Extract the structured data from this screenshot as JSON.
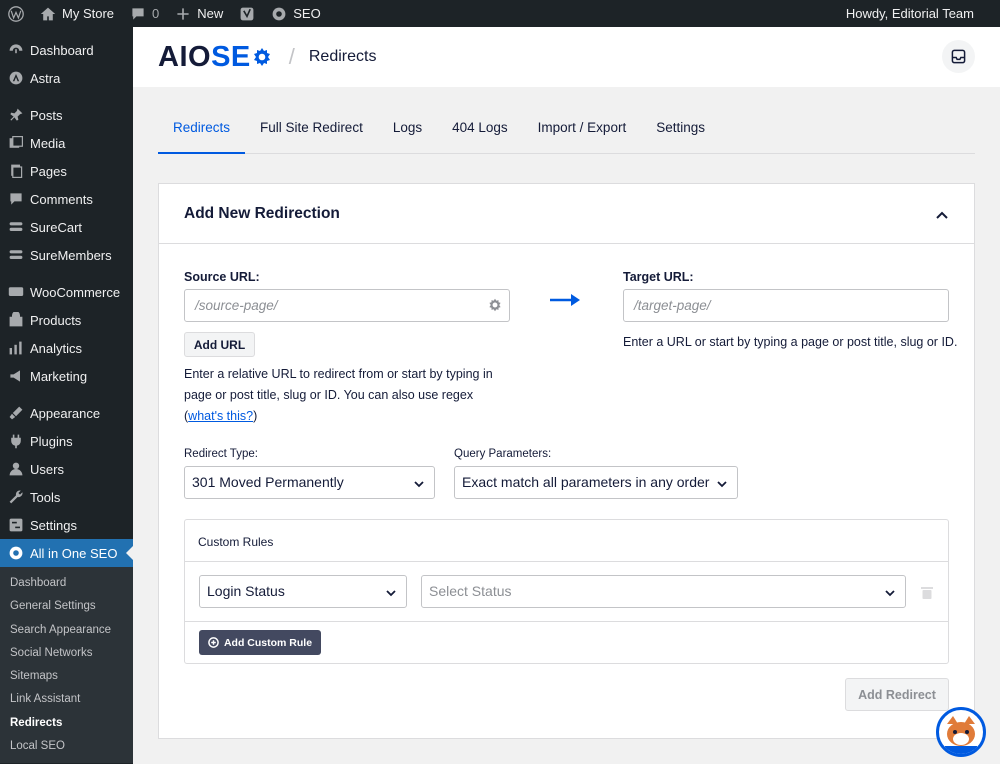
{
  "adminbar": {
    "site": "My Store",
    "comments": "0",
    "new": "New",
    "seo": "SEO",
    "howdy": "Howdy, Editorial Team"
  },
  "sidebar": {
    "items": [
      {
        "label": "Dashboard",
        "icon": "dashboard-icon"
      },
      {
        "label": "Astra",
        "icon": "astra-icon"
      },
      {
        "label": "Posts",
        "icon": "pin-icon"
      },
      {
        "label": "Media",
        "icon": "media-icon"
      },
      {
        "label": "Pages",
        "icon": "pages-icon"
      },
      {
        "label": "Comments",
        "icon": "comment-icon"
      },
      {
        "label": "SureCart",
        "icon": "surecart-icon"
      },
      {
        "label": "SureMembers",
        "icon": "suremembers-icon"
      },
      {
        "label": "WooCommerce",
        "icon": "woocommerce-icon"
      },
      {
        "label": "Products",
        "icon": "products-icon"
      },
      {
        "label": "Analytics",
        "icon": "analytics-icon"
      },
      {
        "label": "Marketing",
        "icon": "megaphone-icon"
      },
      {
        "label": "Appearance",
        "icon": "brush-icon"
      },
      {
        "label": "Plugins",
        "icon": "plug-icon"
      },
      {
        "label": "Users",
        "icon": "user-icon"
      },
      {
        "label": "Tools",
        "icon": "wrench-icon"
      },
      {
        "label": "Settings",
        "icon": "settings-icon"
      },
      {
        "label": "All in One SEO",
        "icon": "aioseo-icon"
      }
    ],
    "submenu": [
      "Dashboard",
      "General Settings",
      "Search Appearance",
      "Social Networks",
      "Sitemaps",
      "Link Assistant",
      "Redirects",
      "Local SEO"
    ]
  },
  "header": {
    "logo_a": "AIO",
    "logo_b": "SE",
    "logo_c": "",
    "title": "Redirects"
  },
  "tabs": [
    "Redirects",
    "Full Site Redirect",
    "Logs",
    "404 Logs",
    "Import / Export",
    "Settings"
  ],
  "card": {
    "title": "Add New Redirection",
    "source_label": "Source URL:",
    "source_placeholder": "/source-page/",
    "add_url": "Add URL",
    "source_hint_pre": "Enter a relative URL to redirect from or start by typing in page or post title, slug or ID. You can also use regex (",
    "source_hint_link": "what's this?",
    "source_hint_post": ")",
    "target_label": "Target URL:",
    "target_placeholder": "/target-page/",
    "target_hint": "Enter a URL or start by typing a page or post title, slug or ID.",
    "redirect_type_label": "Redirect Type:",
    "redirect_type_value": "301 Moved Permanently",
    "query_label": "Query Parameters:",
    "query_value": "Exact match all parameters in any order",
    "custom_rules_title": "Custom Rules",
    "rule_field": "Login Status",
    "rule_value_placeholder": "Select Status",
    "add_custom_rule": "Add Custom Rule",
    "add_redirect": "Add Redirect"
  },
  "colors": {
    "accent": "#005ae0",
    "wp_active": "#2271b1",
    "sidebar_bg": "#1d2327"
  }
}
